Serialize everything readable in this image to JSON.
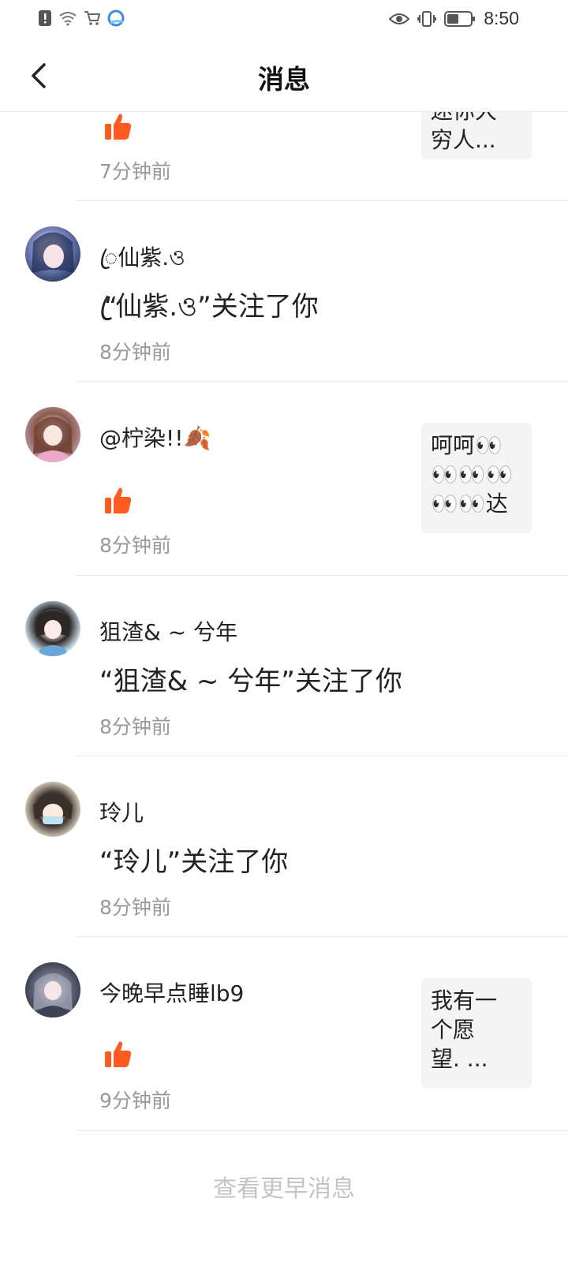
{
  "status_bar": {
    "time": "8:50",
    "icons": [
      "alert-icon",
      "wifi-icon",
      "cart-icon",
      "browser-icon",
      "eye-icon",
      "vibrate-icon",
      "battery-icon"
    ]
  },
  "header": {
    "title": "消息",
    "back_icon": "chevron-left-icon"
  },
  "messages": [
    {
      "type": "like",
      "username": "",
      "time": "7分钟前",
      "preview": "迷你大\n穷人..."
    },
    {
      "type": "follow",
      "username": "ꦿ仙紫.ও",
      "action": "“ꦿ仙紫.ও”关注了你",
      "time": "8分钟前"
    },
    {
      "type": "like",
      "username": "@柠染!!🍂",
      "time": "8分钟前",
      "preview": "呵呵👀\n👀👀👀\n👀👀达"
    },
    {
      "type": "follow",
      "username": "狙渣& ~ 兮年",
      "action": "“狙渣& ~ 兮年”关注了你",
      "time": "8分钟前"
    },
    {
      "type": "follow",
      "username": "玲儿",
      "action": "“玲儿”关注了你",
      "time": "8分钟前"
    },
    {
      "type": "like",
      "username": "今晚早点睡lb9",
      "time": "9分钟前",
      "preview": "我有一\n个愿\n望. ..."
    }
  ],
  "footer": {
    "load_more": "查看更早消息"
  },
  "colors": {
    "accent": "#ff5a1f",
    "muted": "#999999",
    "divider": "#ececec"
  }
}
